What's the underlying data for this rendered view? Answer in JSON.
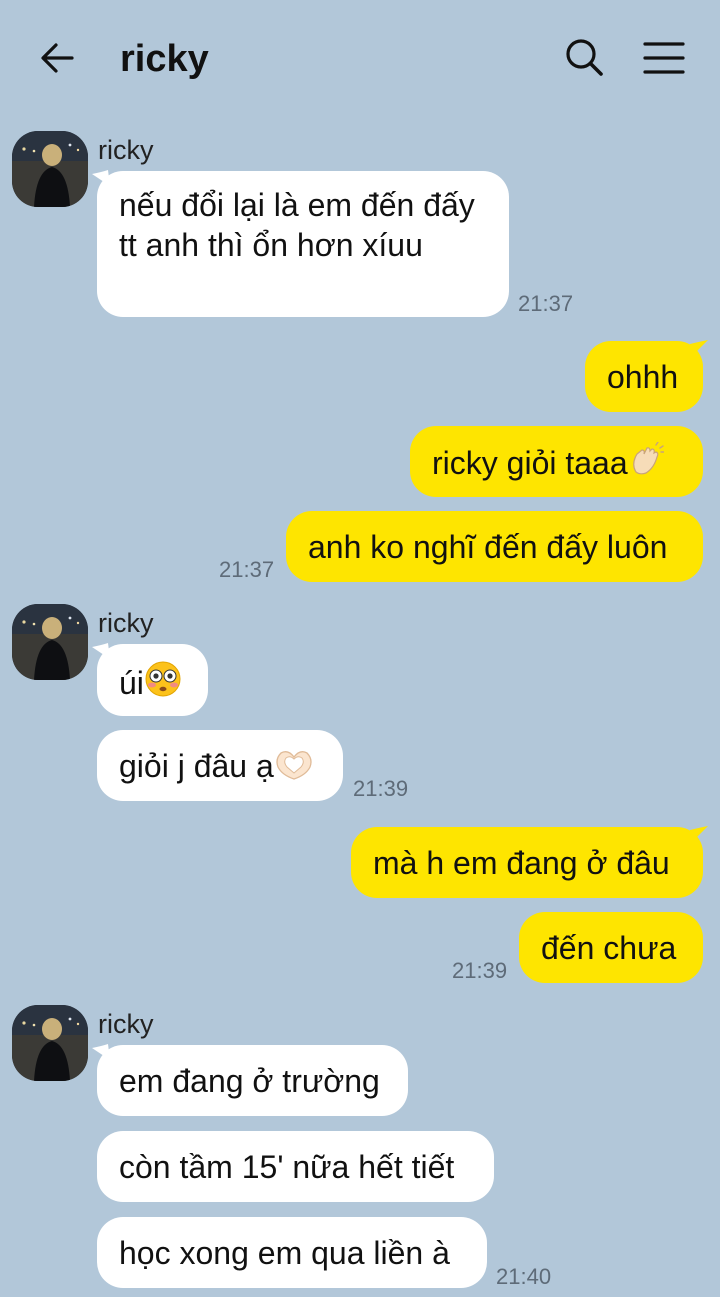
{
  "header": {
    "title": "ricky"
  },
  "messages": {
    "g1": {
      "sender": "ricky",
      "m1": "nếu đổi lại là em đến đấy tt anh thì ổn hơn xíuu",
      "time": "21:37"
    },
    "g2": {
      "m1": "ohhh",
      "m2": "ricky giỏi taaa",
      "m3": "anh ko nghĩ đến đấy luôn",
      "time": "21:37"
    },
    "g3": {
      "sender": "ricky",
      "m1": "úi",
      "m2": "giỏi j đâu ạ",
      "time": "21:39"
    },
    "g4": {
      "m1": "mà h em đang ở đâu",
      "m2": "đến chưa",
      "time": "21:39"
    },
    "g5": {
      "sender": "ricky",
      "m1": "em đang ở trường",
      "m2": "còn tầm 15' nữa hết tiết",
      "m3": "học xong em qua liền à",
      "time": "21:40"
    }
  },
  "icons": [
    "back-arrow-icon",
    "search-icon",
    "menu-icon",
    "clapping-hands-emoji",
    "flushed-face-emoji",
    "heart-hands-emoji"
  ],
  "colors": {
    "background": "#b2c7d9",
    "outgoing": "#fee500",
    "incoming": "#ffffff"
  }
}
